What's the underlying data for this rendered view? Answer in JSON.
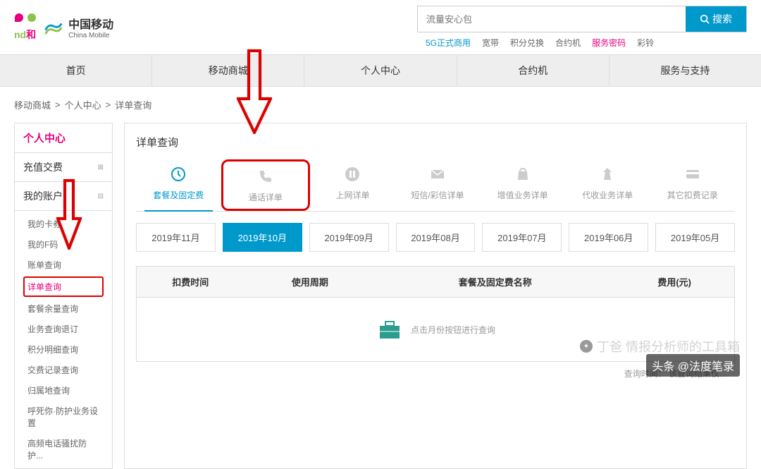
{
  "header": {
    "logo_he": "和",
    "logo_brand": "nd",
    "logo_cn": "中国移动",
    "logo_en": "China Mobile",
    "search_placeholder": "流量安心包",
    "search_button": "搜索",
    "quick_links": [
      {
        "label": "5G正式商用",
        "style": "blue"
      },
      {
        "label": "宽带",
        "style": ""
      },
      {
        "label": "积分兑换",
        "style": ""
      },
      {
        "label": "合约机",
        "style": ""
      },
      {
        "label": "服务密码",
        "style": "red"
      },
      {
        "label": "彩铃",
        "style": ""
      }
    ]
  },
  "nav": [
    "首页",
    "移动商城",
    "个人中心",
    "合约机",
    "服务与支持"
  ],
  "breadcrumb": [
    "移动商城",
    "个人中心",
    "详单查询"
  ],
  "sidebar": {
    "title": "个人中心",
    "sections": [
      {
        "label": "充值交费",
        "expanded": false
      },
      {
        "label": "我的账户",
        "expanded": true
      }
    ],
    "items": [
      {
        "label": "我的卡券",
        "active": false
      },
      {
        "label": "我的F码",
        "active": false
      },
      {
        "label": "账单查询",
        "active": false
      },
      {
        "label": "详单查询",
        "active": true
      },
      {
        "label": "套餐余量查询",
        "active": false
      },
      {
        "label": "业务查询退订",
        "active": false
      },
      {
        "label": "积分明细查询",
        "active": false
      },
      {
        "label": "交费记录查询",
        "active": false
      },
      {
        "label": "归属地查询",
        "active": false
      },
      {
        "label": "呼死你·防护业务设置",
        "active": false
      },
      {
        "label": "高频电话骚扰防护...",
        "active": false
      }
    ]
  },
  "main": {
    "title": "详单查询",
    "tabs": [
      {
        "icon": "clock",
        "label": "套餐及固定费",
        "active": true
      },
      {
        "icon": "phone",
        "label": "通话详单",
        "active": false,
        "highlight": true
      },
      {
        "icon": "pause",
        "label": "上网详单",
        "active": false
      },
      {
        "icon": "mail",
        "label": "短信/彩信详单",
        "active": false
      },
      {
        "icon": "bag",
        "label": "增值业务详单",
        "active": false
      },
      {
        "icon": "money",
        "label": "代收业务详单",
        "active": false
      },
      {
        "icon": "card",
        "label": "其它扣费记录",
        "active": false
      }
    ],
    "months": [
      {
        "label": "2019年11月",
        "active": false
      },
      {
        "label": "2019年10月",
        "active": true
      },
      {
        "label": "2019年09月",
        "active": false
      },
      {
        "label": "2019年08月",
        "active": false
      },
      {
        "label": "2019年07月",
        "active": false
      },
      {
        "label": "2019年06月",
        "active": false
      },
      {
        "label": "2019年05月",
        "active": false
      }
    ],
    "table_headers": [
      "扣费时间",
      "使用周期",
      "套餐及固定费名称",
      "费用(元)"
    ],
    "empty_text": "点击月份按钮进行查询",
    "query_time_label": "查询时间：",
    "query_time_note": "该查询结果仅..."
  },
  "watermarks": {
    "wm1": "丁爸 情报分析师的工具箱",
    "wm2": "头条 @法度笔录"
  }
}
